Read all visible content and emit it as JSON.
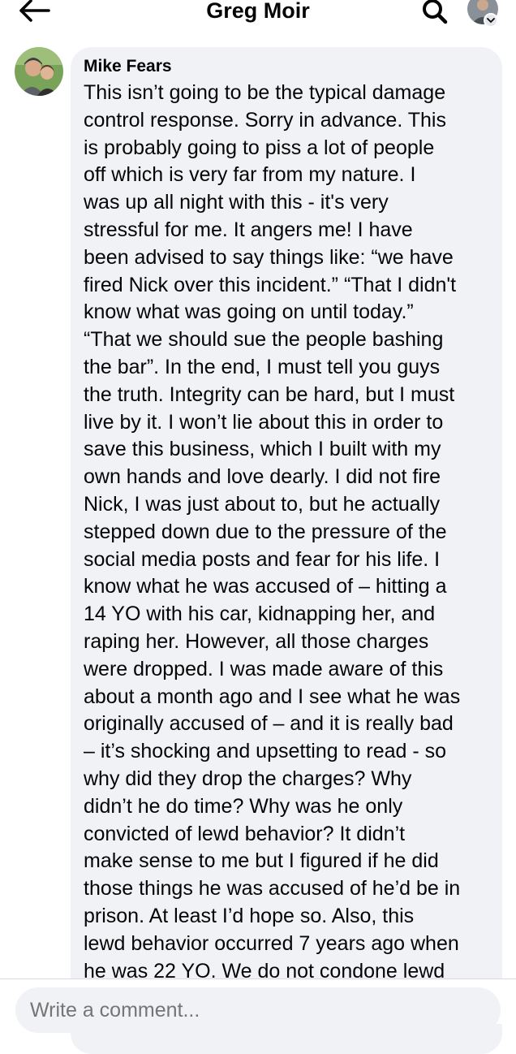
{
  "header": {
    "title": "Greg Moir",
    "back_icon": "arrow-left-icon",
    "search_icon": "search-icon",
    "profile_icon": "profile-avatar-icon"
  },
  "comment": {
    "author": "Mike Fears",
    "avatar_icon": "user-avatar-photo",
    "text": "This isn’t going to be the typical damage\ncontrol response. Sorry in advance. This\nis probably going to piss a lot of people\noff which is very far from my nature. I\nwas up all night with this - it's very\nstressful for me. It angers me! I have\nbeen advised to say things like: “we have\nfired Nick over this incident.” “That I didn't\nknow what was going on until today.”\n“That we should sue the people bashing\nthe bar”. In the end, I must tell you guys\nthe truth. Integrity can be hard, but I must\nlive by it. I won’t lie about this in order to\nsave this business, which I built with my\nown hands and love dearly. I did not fire\nNick, I was just about to, but he actually\nstepped down due to the pressure of the\nsocial media posts and fear for his life. I\nknow what he was accused of – hitting a\n14 YO with his car, kidnapping her, and\nraping her. However, all those charges\nwere dropped. I was made aware of this\nabout a month ago and I see what he was\noriginally accused of – and it is really bad\n– it’s shocking and upsetting to read - so\nwhy did they drop the charges? Why\ndidn’t he do time? Why was he only\nconvicted of lewd behavior? It didn’t\nmake sense to me but I figured if he did\nthose things he was accused of he’d be in\nprison. At least I’d hope so. Also, this\nlewd behavior occurred 7 years ago when\nhe was 22 YO. We do not condone lewd"
  },
  "composer": {
    "placeholder": "Write a comment..."
  },
  "colors": {
    "bubble_bg": "#f0f2f5",
    "text": "#050505",
    "placeholder": "#65676b"
  }
}
